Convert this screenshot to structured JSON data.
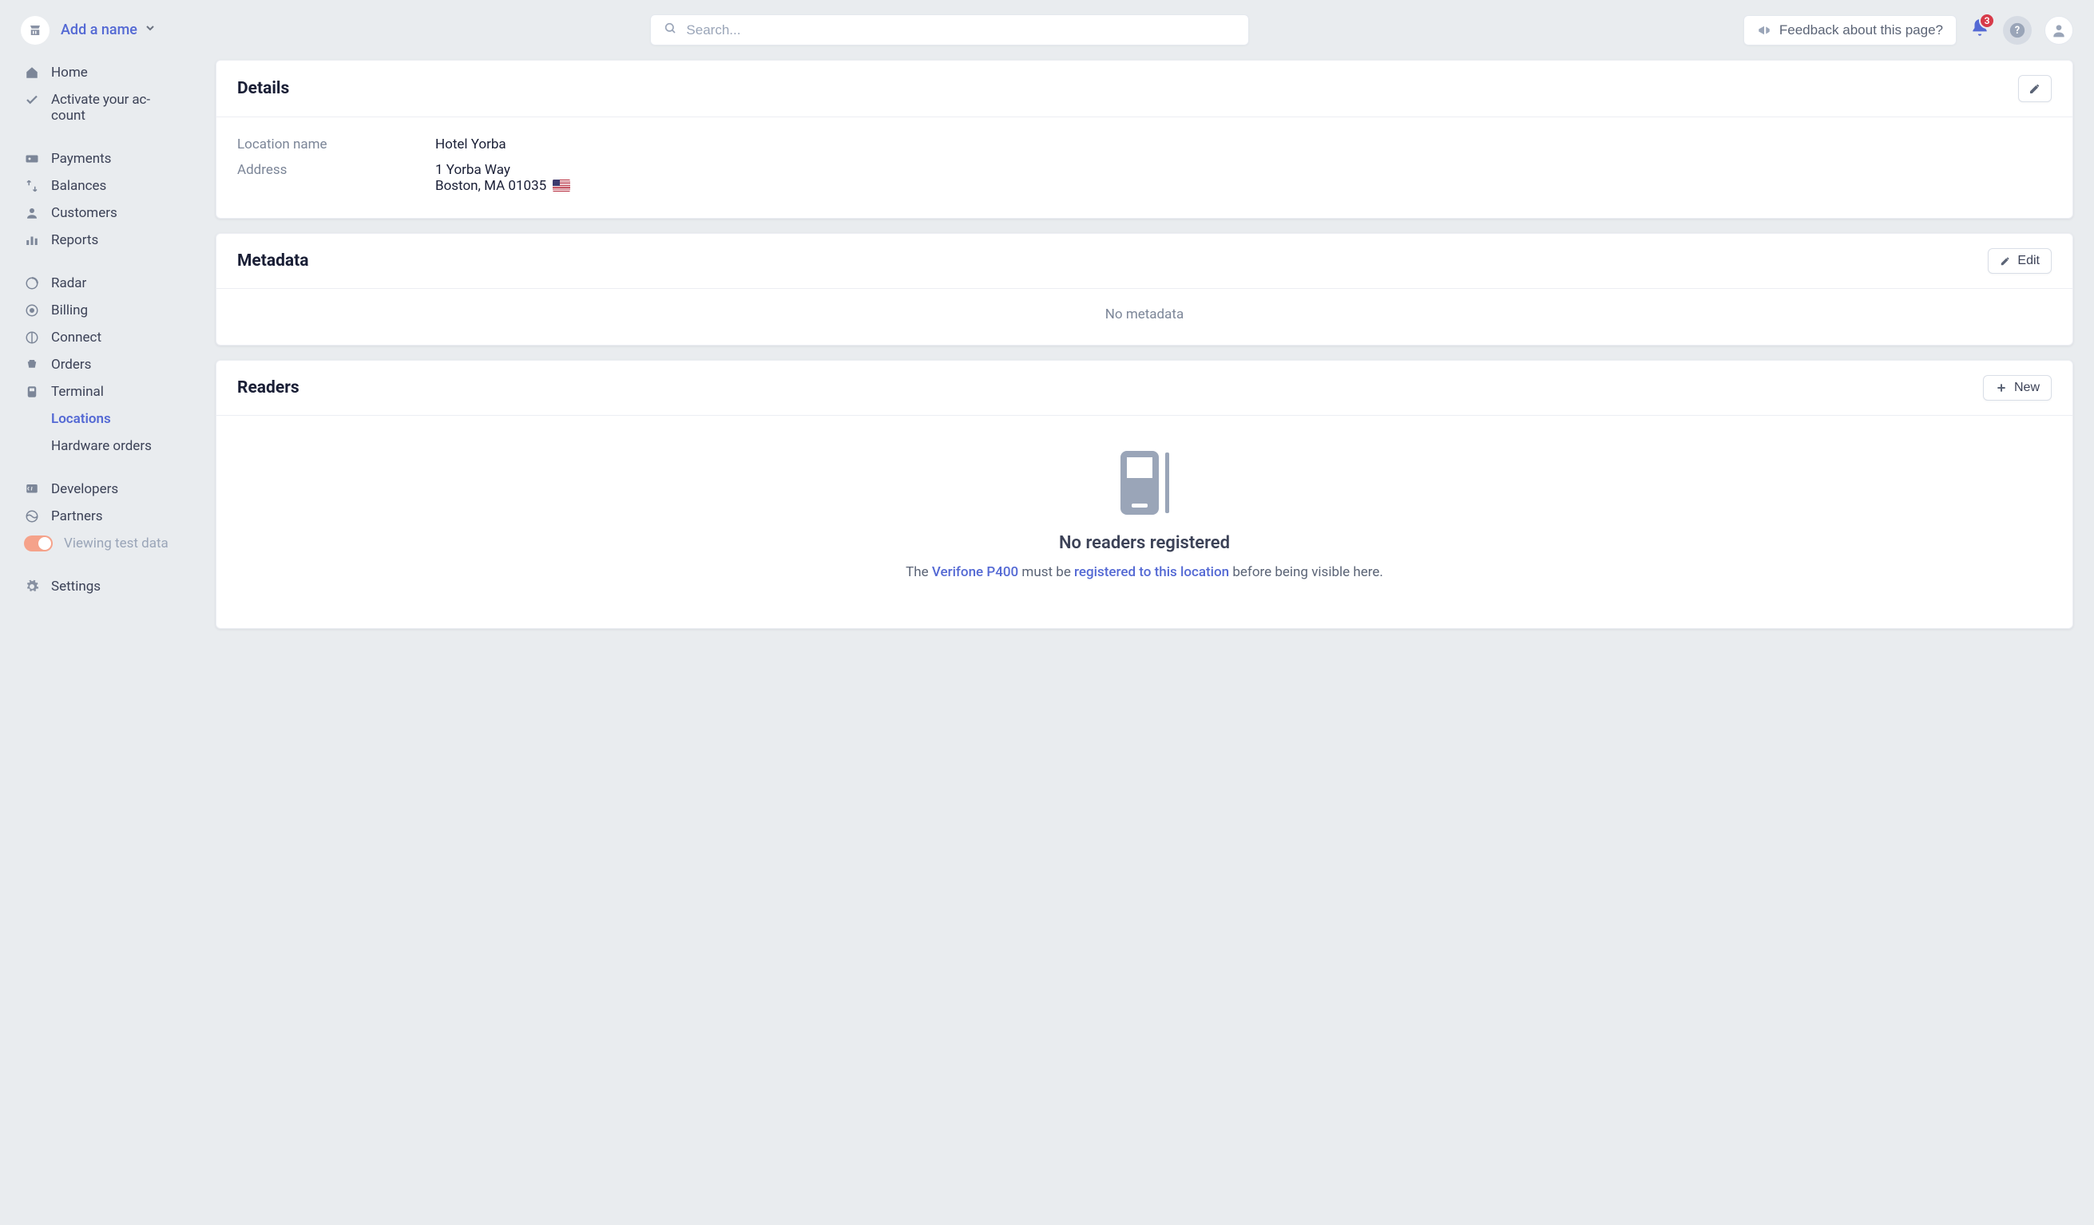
{
  "header": {
    "brand_label": "Add a name",
    "search_placeholder": "Search...",
    "feedback_label": "Feedback about this page?",
    "notification_count": "3"
  },
  "sidebar": {
    "home": "Home",
    "activate": "Activate your account",
    "activate_line1": "Activate your ac-",
    "activate_line2": "count",
    "payments": "Payments",
    "balances": "Balances",
    "customers": "Customers",
    "reports": "Reports",
    "radar": "Radar",
    "billing": "Billing",
    "connect": "Connect",
    "orders": "Orders",
    "terminal": "Terminal",
    "terminal_locations": "Locations",
    "terminal_hardware": "Hardware orders",
    "developers": "Developers",
    "partners": "Partners",
    "test_data_label": "Viewing test data",
    "settings": "Settings"
  },
  "details": {
    "title": "Details",
    "location_name_label": "Location name",
    "location_name_value": "Hotel Yorba",
    "address_label": "Address",
    "address_line1": "1 Yorba Way",
    "address_line2": "Boston, MA 01035"
  },
  "metadata": {
    "title": "Metadata",
    "edit_label": "Edit",
    "empty": "No metadata"
  },
  "readers": {
    "title": "Readers",
    "new_label": "New",
    "empty_title": "No readers registered",
    "sub_prefix": "The ",
    "product_link": "Verifone P400",
    "sub_mid": " must be ",
    "register_link": "registered to this location",
    "sub_suffix": " before being visible here."
  }
}
